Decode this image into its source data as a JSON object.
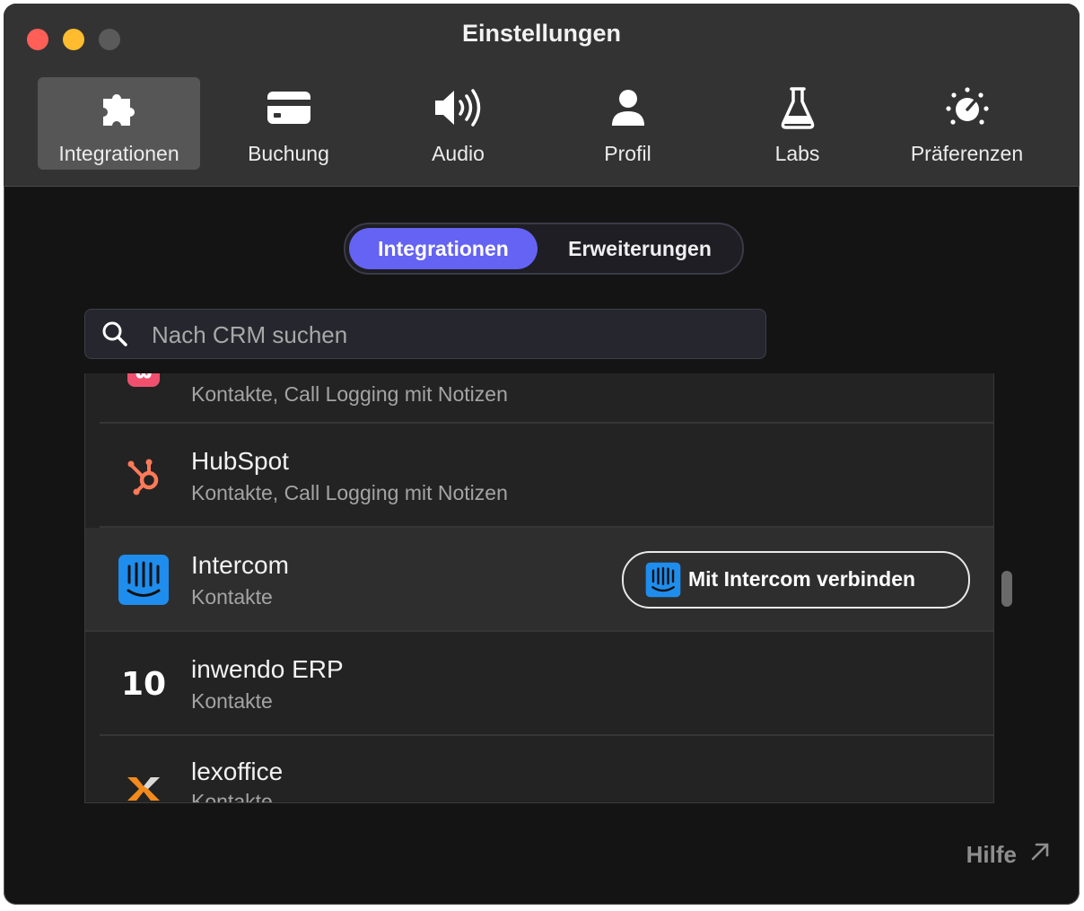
{
  "window": {
    "title": "Einstellungen"
  },
  "tabs": [
    {
      "label": "Integrationen",
      "icon": "puzzle-icon",
      "active": true
    },
    {
      "label": "Buchung",
      "icon": "credit-card-icon",
      "active": false
    },
    {
      "label": "Audio",
      "icon": "speaker-icon",
      "active": false
    },
    {
      "label": "Profil",
      "icon": "person-icon",
      "active": false
    },
    {
      "label": "Labs",
      "icon": "flask-icon",
      "active": false
    },
    {
      "label": "Präferenzen",
      "icon": "dial-icon",
      "active": false
    }
  ],
  "segment": {
    "integrations": "Integrationen",
    "extensions": "Erweiterungen",
    "selected": "Integrationen"
  },
  "search": {
    "placeholder": "Nach CRM suchen",
    "value": ""
  },
  "list": {
    "items": [
      {
        "name": "",
        "desc": "Kontakte, Call Logging mit Notizen",
        "icon": "pink-crm-icon"
      },
      {
        "name": "HubSpot",
        "desc": "Kontakte, Call Logging mit Notizen",
        "icon": "hubspot-icon"
      },
      {
        "name": "Intercom",
        "desc": "Kontakte",
        "icon": "intercom-icon",
        "action": "Mit Intercom verbinden"
      },
      {
        "name": "inwendo ERP",
        "desc": "Kontakte",
        "icon": "inwendo-icon",
        "logo_text": "10"
      },
      {
        "name": "lexoffice",
        "desc": "Kontakte",
        "icon": "lexoffice-icon"
      }
    ]
  },
  "footer": {
    "help": "Hilfe"
  },
  "colors": {
    "accent": "#6563f3",
    "intercom": "#1f8ded",
    "hubspot": "#ff7a59",
    "lexoffice": "#f28a1c",
    "pink": "#f0506e"
  }
}
